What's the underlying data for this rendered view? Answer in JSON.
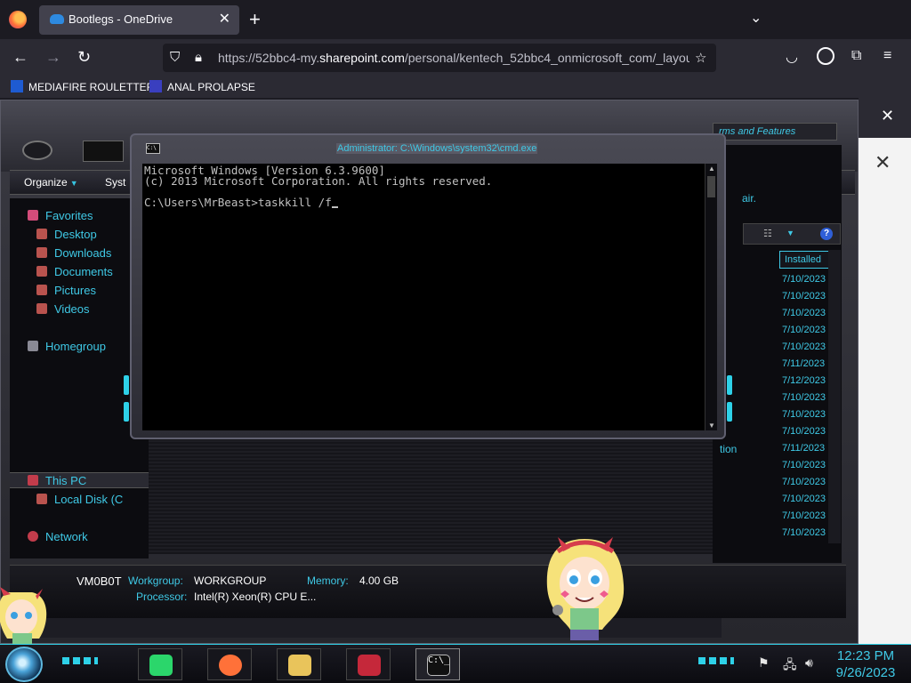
{
  "browser": {
    "tab": {
      "title": "Bootlegs - OneDrive",
      "icon": "onedrive-cloud-icon"
    },
    "url": {
      "prefix": "https://52bbc4-my.",
      "host": "sharepoint.com",
      "path": "/personal/kentech_52bbc4_onmicrosoft_com/_layou"
    },
    "bookmarks": [
      {
        "label": "MEDIAFIRE ROULETTER",
        "icon": "mediafire-icon"
      },
      {
        "label": "ANAL PROLAPSE",
        "icon": "bookmark-icon"
      }
    ]
  },
  "explorer": {
    "commands": {
      "organize": "Organize",
      "system_properties": "Syst"
    },
    "nav": {
      "favorites": "Favorites",
      "desktop": "Desktop",
      "downloads": "Downloads",
      "documents": "Documents",
      "pictures": "Pictures",
      "videos": "Videos",
      "homegroup": "Homegroup",
      "this_pc": "This PC",
      "local_disk": "Local Disk (C",
      "network": "Network"
    },
    "search_placeholder": "rms and Features",
    "repair_text": "air.",
    "installed_header": "Installed",
    "tion_text": "tion",
    "installed_dates": [
      "7/10/2023",
      "7/10/2023",
      "7/10/2023",
      "7/10/2023",
      "7/10/2023",
      "7/11/2023",
      "7/12/2023",
      "7/10/2023",
      "7/10/2023",
      "7/10/2023",
      "7/11/2023",
      "7/10/2023",
      "7/10/2023",
      "7/10/2023",
      "7/10/2023",
      "7/10/2023"
    ],
    "details": {
      "computer_name": "VM0B0T",
      "workgroup_label": "Workgroup:",
      "workgroup_value": "WORKGROUP",
      "memory_label": "Memory:",
      "memory_value": "4.00 GB",
      "processor_label": "Processor:",
      "processor_value": "Intel(R) Xeon(R) CPU E..."
    }
  },
  "cmd": {
    "title": "Administrator: C:\\Windows\\system32\\cmd.exe",
    "lines": [
      "Microsoft Windows [Version 6.3.9600]",
      "(c) 2013 Microsoft Corporation. All rights reserved.",
      "",
      "C:\\Users\\MrBeast>taskkill /f"
    ]
  },
  "taskbar": {
    "pinned": [
      {
        "name": "notes-app",
        "icon": "green-notes-icon",
        "color": "#2bd66b"
      },
      {
        "name": "firefox",
        "icon": "firefox-icon",
        "color": "#ff7139"
      },
      {
        "name": "file-explorer",
        "icon": "folder-icon",
        "color": "#e9c45b"
      },
      {
        "name": "control-panel",
        "icon": "red-system-icon",
        "color": "#c5283a"
      },
      {
        "name": "command-prompt",
        "icon": "cmd-icon",
        "color": "#111111"
      }
    ],
    "clock": {
      "time": "12:23 PM",
      "date": "9/26/2023"
    }
  },
  "colors": {
    "accent": "#3fc9e6",
    "glow": "#2ed1e8",
    "browser_bg": "#1c1b22"
  }
}
